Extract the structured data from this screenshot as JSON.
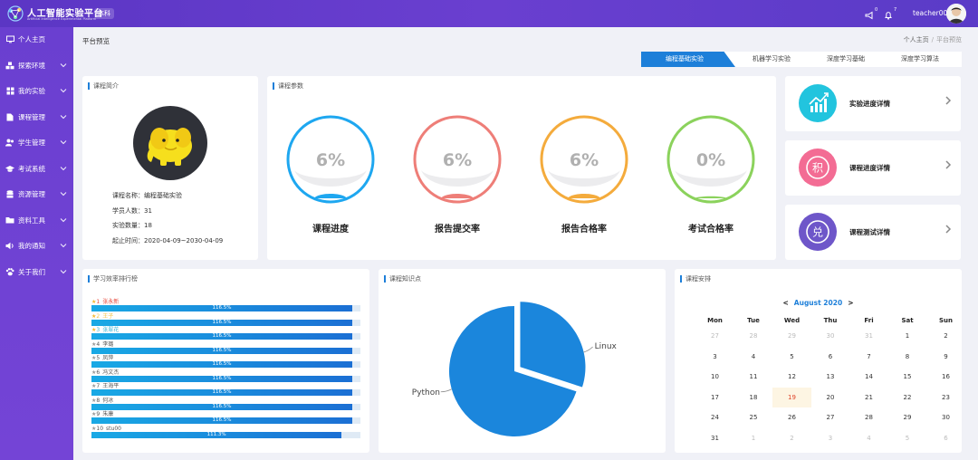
{
  "header": {
    "brand_title": "人工智能实验平台",
    "brand_subtitle": "Artificial Intelligence Experimental Platform",
    "level_badge": "本科",
    "broadcast_count": "0",
    "bell_count": "7",
    "username": "teacher00"
  },
  "sidebar": {
    "items": [
      {
        "label": "个人主页",
        "icon": "monitor-icon",
        "has_chevron": false
      },
      {
        "label": "探索环境",
        "icon": "cubes-icon",
        "has_chevron": true
      },
      {
        "label": "我的实验",
        "icon": "grid-icon",
        "has_chevron": true
      },
      {
        "label": "课程管理",
        "icon": "document-icon",
        "has_chevron": true
      },
      {
        "label": "学生管理",
        "icon": "users-icon",
        "has_chevron": true
      },
      {
        "label": "考试系统",
        "icon": "graduation-cap-icon",
        "has_chevron": true
      },
      {
        "label": "资源管理",
        "icon": "database-icon",
        "has_chevron": true
      },
      {
        "label": "资料工具",
        "icon": "folder-icon",
        "has_chevron": true
      },
      {
        "label": "我的通知",
        "icon": "volume-icon",
        "has_chevron": true
      },
      {
        "label": "关于我们",
        "icon": "paw-icon",
        "has_chevron": true
      }
    ]
  },
  "page": {
    "title": "平台预览",
    "breadcrumb_home": "个人主页",
    "breadcrumb_current": "平台预览"
  },
  "tabs": [
    {
      "label": "编程基础实验",
      "active": true
    },
    {
      "label": "机器学习实验",
      "active": false
    },
    {
      "label": "深度学习基础",
      "active": false
    },
    {
      "label": "深度学习算法",
      "active": false
    }
  ],
  "intro": {
    "title": "课程简介",
    "lines": [
      "课程名称：编程基础实验",
      "学员人数：31",
      "实验数量：18",
      "起止时间：2020-04-09~2030-04-09"
    ]
  },
  "params": {
    "title": "课程参数",
    "gauges": [
      {
        "label": "课程进度",
        "value_text": "6%",
        "fraction": 0.06,
        "color": "#1ea7f0"
      },
      {
        "label": "报告提交率",
        "value_text": "6%",
        "fraction": 0.06,
        "color": "#ee7e78"
      },
      {
        "label": "报告合格率",
        "value_text": "6%",
        "fraction": 0.06,
        "color": "#f4ab3c"
      },
      {
        "label": "考试合格率",
        "value_text": "0%",
        "fraction": 0.0,
        "color": "#8bd25c"
      }
    ]
  },
  "details": [
    {
      "label": "实验进度详情",
      "icon": "growth-chart-icon",
      "color": "#22c4de"
    },
    {
      "label": "课程进度详情",
      "icon": "points-icon",
      "glyph": "积",
      "color": "#f36c94"
    },
    {
      "label": "课程测试详情",
      "icon": "redeem-icon",
      "glyph": "兑",
      "color": "#6e56c9"
    }
  ],
  "ranking": {
    "title": "学习效率排行榜",
    "rows": [
      {
        "rank": "1",
        "name": "张永新",
        "value_text": "116.5%",
        "fraction": 0.97,
        "name_color": "#e7483b",
        "star": "#f5b82e"
      },
      {
        "rank": "2",
        "name": "王子",
        "value_text": "116.5%",
        "fraction": 0.97,
        "name_color": "#f0c34a",
        "star": "#f5b82e"
      },
      {
        "rank": "3",
        "name": "张翠花",
        "value_text": "116.5%",
        "fraction": 0.97,
        "name_color": "#3bb5d6",
        "star": "#f5b82e"
      },
      {
        "rank": "4",
        "name": "李璐",
        "value_text": "116.5%",
        "fraction": 0.97,
        "name_color": "#555",
        "star": "#999"
      },
      {
        "rank": "5",
        "name": "凤萍",
        "value_text": "116.5%",
        "fraction": 0.97,
        "name_color": "#555",
        "star": "#999"
      },
      {
        "rank": "6",
        "name": "冯文杰",
        "value_text": "116.5%",
        "fraction": 0.97,
        "name_color": "#555",
        "star": "#999"
      },
      {
        "rank": "7",
        "name": "王海平",
        "value_text": "116.5%",
        "fraction": 0.97,
        "name_color": "#555",
        "star": "#999"
      },
      {
        "rank": "8",
        "name": "何冰",
        "value_text": "116.5%",
        "fraction": 0.97,
        "name_color": "#555",
        "star": "#999"
      },
      {
        "rank": "9",
        "name": "朱康",
        "value_text": "116.5%",
        "fraction": 0.97,
        "name_color": "#555",
        "star": "#999"
      },
      {
        "rank": "10",
        "name": "stu00",
        "value_text": "111.3%",
        "fraction": 0.93,
        "name_color": "#555",
        "star": "#999"
      }
    ]
  },
  "knowledge": {
    "title": "课程知识点"
  },
  "chart_data": {
    "type": "pie",
    "categories": [
      "Python",
      "Linux"
    ],
    "values": [
      0.7,
      0.3
    ],
    "title": "",
    "color": "#1b86dc"
  },
  "calendar": {
    "title": "课程安排",
    "month_label": "August 2020",
    "prev": "<",
    "next": ">",
    "weekdays": [
      "Mon",
      "Tue",
      "Wed",
      "Thu",
      "Fri",
      "Sat",
      "Sun"
    ],
    "weeks": [
      [
        "27",
        "28",
        "29",
        "30",
        "31",
        "1",
        "2"
      ],
      [
        "3",
        "4",
        "5",
        "6",
        "7",
        "8",
        "9"
      ],
      [
        "10",
        "11",
        "12",
        "13",
        "14",
        "15",
        "16"
      ],
      [
        "17",
        "18",
        "19",
        "20",
        "21",
        "22",
        "23"
      ],
      [
        "24",
        "25",
        "26",
        "27",
        "28",
        "29",
        "30"
      ],
      [
        "31",
        "1",
        "2",
        "3",
        "4",
        "5",
        "6"
      ]
    ],
    "today": "19"
  }
}
